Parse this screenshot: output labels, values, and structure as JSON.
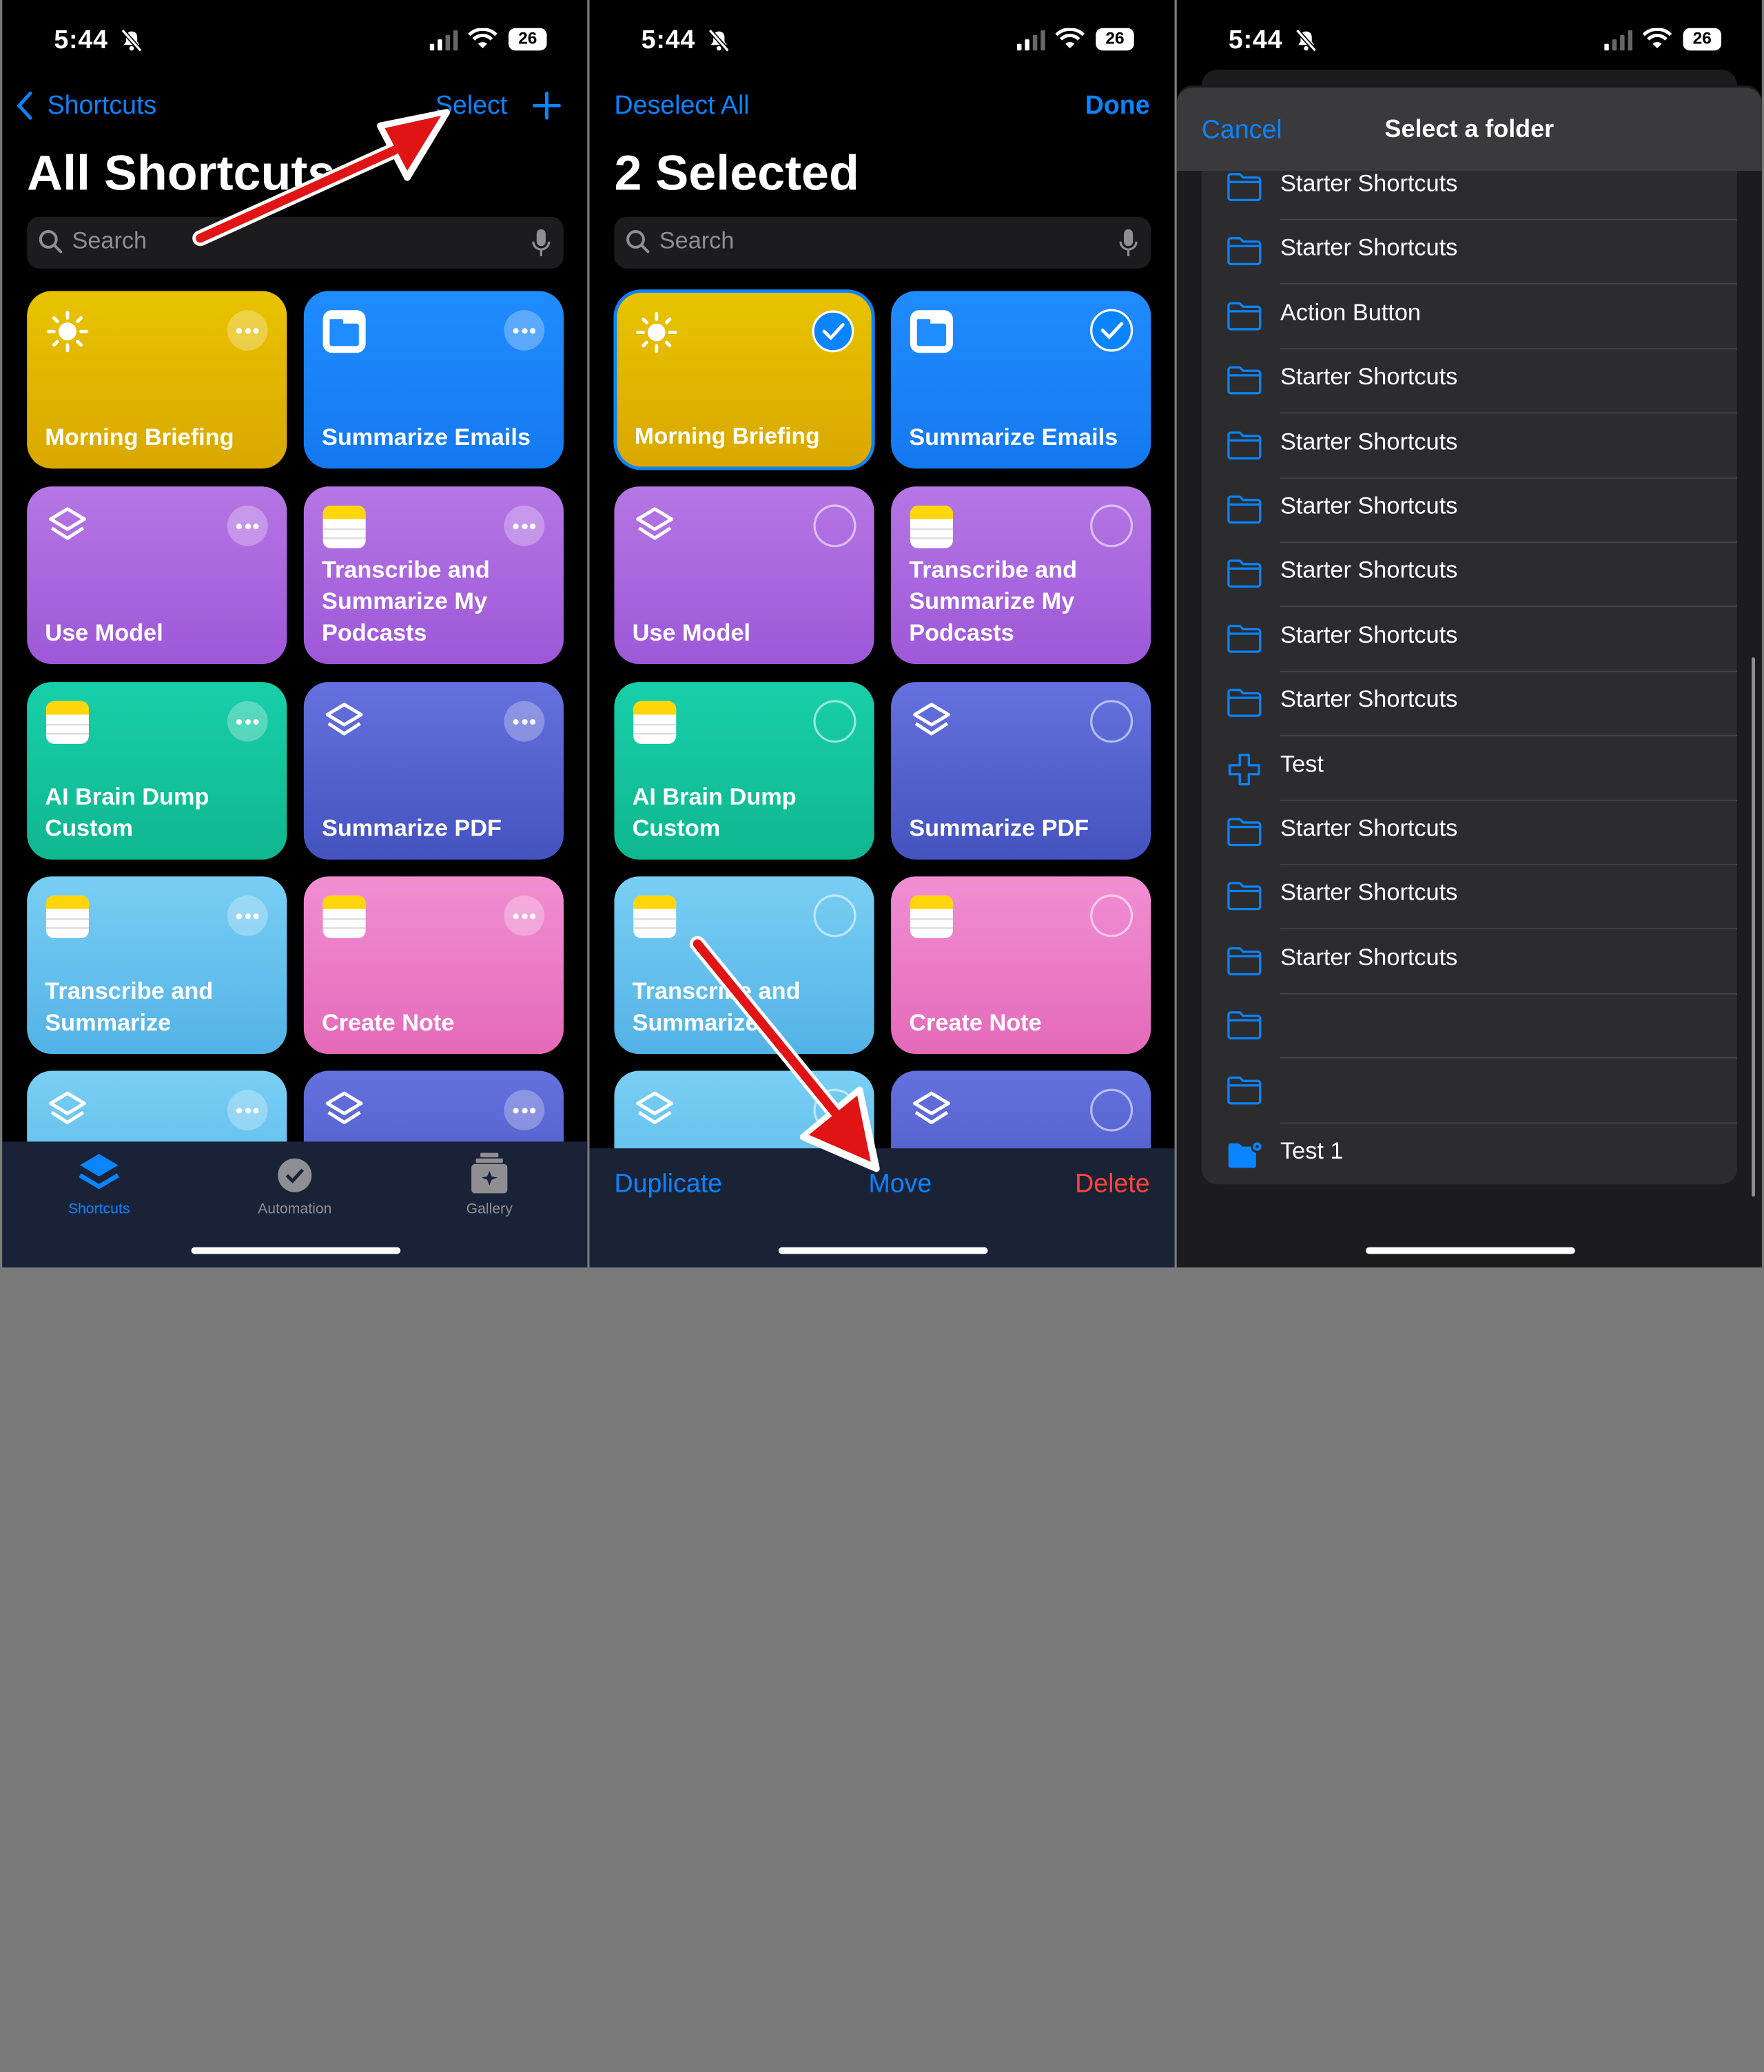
{
  "status_bar": {
    "time": "5:44",
    "battery": "26"
  },
  "panel1": {
    "back_label": "Shortcuts",
    "select_label": "Select",
    "title": "All Shortcuts",
    "search_placeholder": "Search",
    "cards": [
      {
        "label": "Morning Briefing",
        "color": "yellow",
        "icon": "sun-icon"
      },
      {
        "label": "Summarize Emails",
        "color": "blue",
        "icon": "window-icon"
      },
      {
        "label": "Use Model",
        "color": "purple",
        "icon": "layers-icon"
      },
      {
        "label": "Transcribe and Summarize My Podcasts",
        "color": "purple",
        "icon": "notes-icon"
      },
      {
        "label": "AI Brain Dump Custom",
        "color": "teal",
        "icon": "notes-icon"
      },
      {
        "label": "Summarize PDF",
        "color": "indigo",
        "icon": "layers-icon"
      },
      {
        "label": "Transcribe and Summarize",
        "color": "sky",
        "icon": "notes-icon"
      },
      {
        "label": "Create Note",
        "color": "pink",
        "icon": "notes-icon"
      }
    ],
    "tabs": [
      {
        "label": "Shortcuts",
        "icon": "layers-icon",
        "active": true
      },
      {
        "label": "Automation",
        "icon": "clock-check-icon",
        "active": false
      },
      {
        "label": "Gallery",
        "icon": "gallery-icon",
        "active": false
      }
    ]
  },
  "panel2": {
    "deselect_label": "Deselect All",
    "done_label": "Done",
    "title": "2 Selected",
    "search_placeholder": "Search",
    "selected_cards": [
      "Morning Briefing",
      "Summarize Emails"
    ],
    "actions": {
      "duplicate": "Duplicate",
      "move": "Move",
      "delete": "Delete"
    }
  },
  "panel3": {
    "cancel_label": "Cancel",
    "title": "Select a folder",
    "folders": [
      {
        "label": "Starter Shortcuts",
        "icon": "folder-icon"
      },
      {
        "label": "Starter Shortcuts",
        "icon": "folder-icon"
      },
      {
        "label": "Action Button",
        "icon": "folder-icon"
      },
      {
        "label": "Starter Shortcuts",
        "icon": "folder-icon"
      },
      {
        "label": "Starter Shortcuts",
        "icon": "folder-icon"
      },
      {
        "label": "Starter Shortcuts",
        "icon": "folder-icon"
      },
      {
        "label": "Starter Shortcuts",
        "icon": "folder-icon"
      },
      {
        "label": "Starter Shortcuts",
        "icon": "folder-icon"
      },
      {
        "label": "Starter Shortcuts",
        "icon": "folder-icon"
      },
      {
        "label": "Test",
        "icon": "plus-outline-icon"
      },
      {
        "label": "Starter Shortcuts",
        "icon": "folder-icon"
      },
      {
        "label": "Starter Shortcuts",
        "icon": "folder-icon"
      },
      {
        "label": "Starter Shortcuts",
        "icon": "folder-icon"
      },
      {
        "label": "",
        "icon": "folder-icon"
      },
      {
        "label": "",
        "icon": "folder-icon"
      },
      {
        "label": "Test 1",
        "icon": "folder-gear-icon"
      }
    ]
  },
  "colors": {
    "accent": "#0a84ff",
    "destructive": "#ff453a",
    "arrow": "#e01414"
  }
}
